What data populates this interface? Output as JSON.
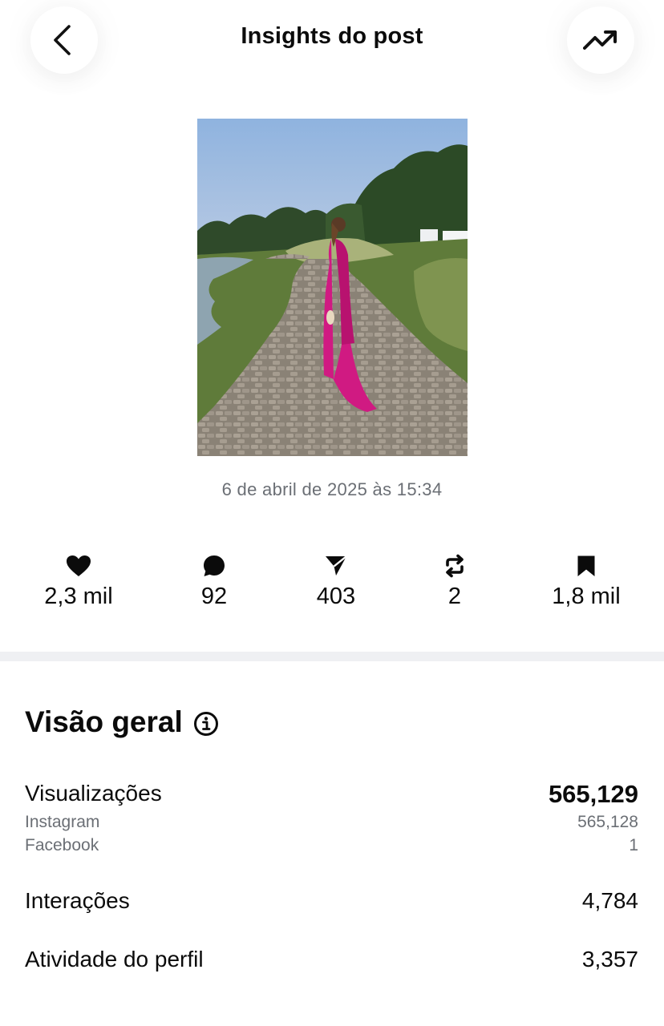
{
  "header": {
    "title": "Insights do post",
    "back_icon": "chevron-left-icon",
    "trend_icon": "trending-up-icon"
  },
  "post": {
    "image_alt": "Woman in long magenta dress on a paved garden path at sunset",
    "date": "6 de abril de 2025 às 15:34"
  },
  "stats": [
    {
      "icon": "heart-icon",
      "value": "2,3 mil"
    },
    {
      "icon": "comment-icon",
      "value": "92"
    },
    {
      "icon": "send-icon",
      "value": "403"
    },
    {
      "icon": "repost-icon",
      "value": "2"
    },
    {
      "icon": "bookmark-icon",
      "value": "1,8 mil"
    }
  ],
  "overview": {
    "title": "Visão geral",
    "info_icon": "info-icon",
    "views": {
      "label": "Visualizações",
      "value": "565,129",
      "breakdown": [
        {
          "label": "Instagram",
          "value": "565,128"
        },
        {
          "label": "Facebook",
          "value": "1"
        }
      ]
    },
    "interactions": {
      "label": "Interações",
      "value": "4,784"
    },
    "profile_activity": {
      "label": "Atividade do perfil",
      "value": "3,357"
    }
  },
  "colors": {
    "text": "#0b0b0b",
    "secondary_text": "#6b6f75",
    "divider": "#eff0f3",
    "dress": "#d01a82"
  }
}
